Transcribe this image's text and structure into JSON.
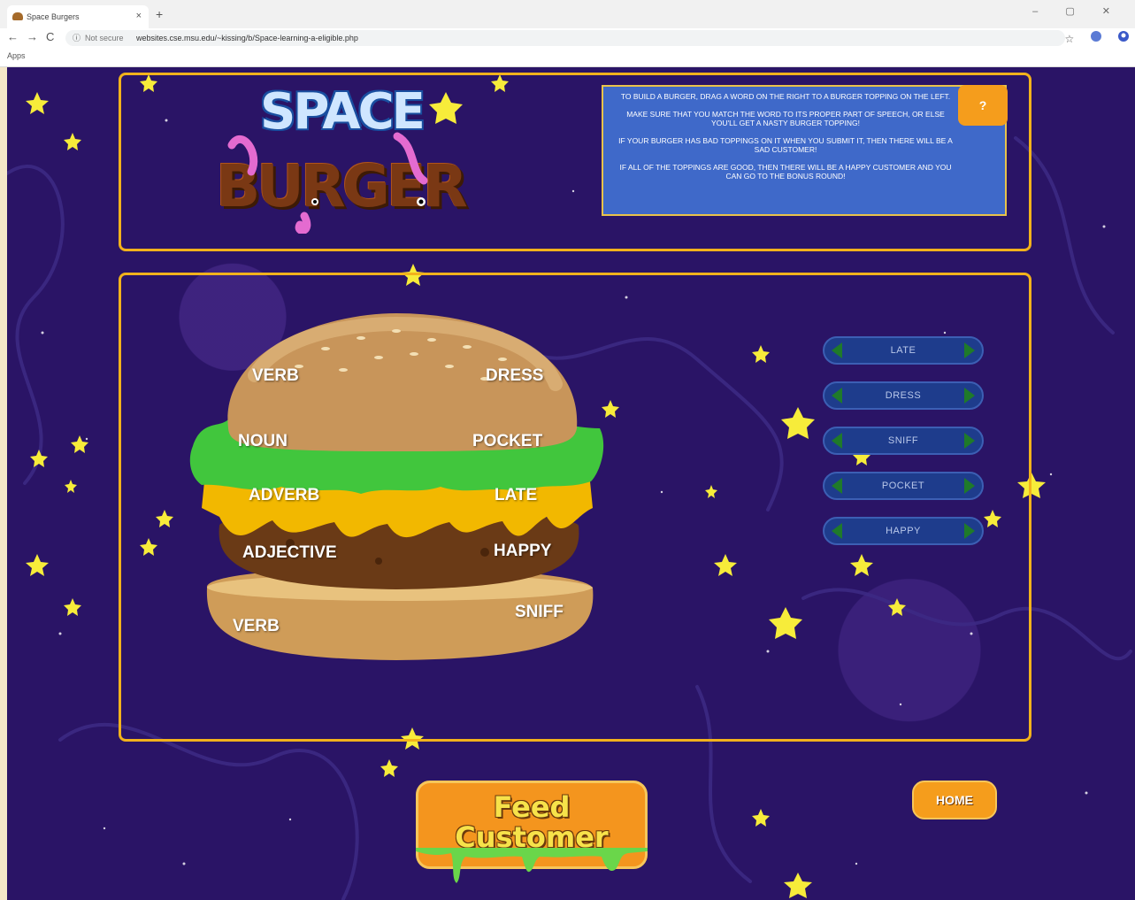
{
  "browser": {
    "tab_title": "Space Burgers",
    "tab_close": "×",
    "new_tab": "+",
    "window_controls": "– ▢ ✕",
    "nav_back": "←",
    "nav_forward": "→",
    "nav_reload": "C",
    "info_icon": "ⓘ",
    "not_secure": "Not secure",
    "url": "websites.cse.msu.edu/~kissing/b/Space-learning-a-eligible.php",
    "bookmark_star": "☆",
    "apps_label": "Apps"
  },
  "logo": {
    "line1": "SPACE",
    "line2": "BURGER"
  },
  "instructions": {
    "lines": [
      "TO BUILD A BURGER, DRAG A WORD ON THE RIGHT TO A BURGER TOPPING ON THE LEFT.",
      "MAKE SURE THAT YOU MATCH THE WORD TO ITS PROPER PART OF SPEECH, OR ELSE YOU'LL GET A NASTY BURGER TOPPING!",
      "IF YOUR BURGER HAS BAD TOPPINGS ON IT WHEN YOU SUBMIT IT, THEN THERE WILL BE A SAD CUSTOMER!",
      "IF ALL OF THE TOPPINGS ARE GOOD, THEN THERE WILL BE A HAPPY CUSTOMER AND YOU CAN GO TO THE BONUS ROUND!"
    ],
    "help_label": "?"
  },
  "burger": {
    "top_bun": {
      "left": "VERB",
      "right": "DRESS"
    },
    "lettuce": {
      "left": "NOUN",
      "right": "POCKET"
    },
    "cheese": {
      "left": "ADVERB",
      "right": "LATE"
    },
    "patty": {
      "left": "ADJECTIVE",
      "right": "HAPPY"
    },
    "bottom_bun": {
      "left": "VERB",
      "right": "SNIFF"
    }
  },
  "words": [
    "LATE",
    "DRESS",
    "SNIFF",
    "POCKET",
    "HAPPY"
  ],
  "feed_button": {
    "line1": "Feed",
    "line2": "Customer"
  },
  "home_button": "HOME",
  "colors": {
    "background": "#2a1466",
    "panel_border": "#f2b21c",
    "button_orange": "#f4951e",
    "instructions_blue": "#3f69c9"
  }
}
